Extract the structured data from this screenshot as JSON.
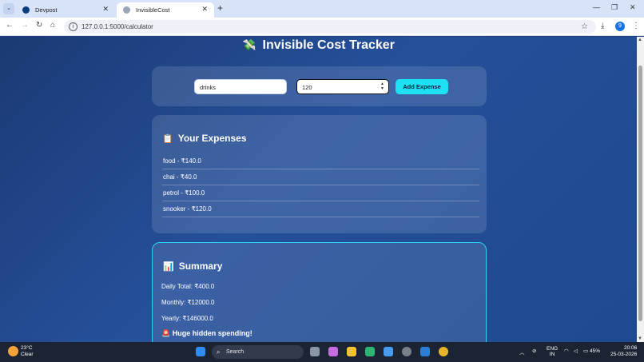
{
  "browser": {
    "tabs": [
      {
        "label": "Devpost"
      },
      {
        "label": "InvisibleCost"
      }
    ],
    "url": "127.0.0.1:5000/calculator",
    "profile_initial": "9"
  },
  "app": {
    "title": "Invisible Cost Tracker",
    "title_emoji": "💸",
    "form": {
      "name_value": "drinks",
      "amount_value": "120",
      "add_label": "Add Expense"
    },
    "expenses": {
      "heading": "Your Expenses",
      "heading_emoji": "📋",
      "items": [
        {
          "label": "food - ₹140.0"
        },
        {
          "label": "chai - ₹40.0"
        },
        {
          "label": "petrol - ₹100.0"
        },
        {
          "label": "snooker - ₹120.0"
        }
      ]
    },
    "summary": {
      "heading": "Summary",
      "heading_emoji": "📊",
      "daily": "Daily Total: ₹400.0",
      "monthly": "Monthly: ₹12000.0",
      "yearly": "Yearly: ₹146000.0",
      "warning": "Huge hidden spending!",
      "warning_emoji": "🚨"
    }
  },
  "taskbar": {
    "weather_temp": "23°C",
    "weather_desc": "Clear",
    "search_placeholder": "Search",
    "lang_top": "ENG",
    "lang_bottom": "IN",
    "battery": "45%",
    "time": "20:06",
    "date": "25-03-2026"
  },
  "colors": {
    "accent_button": "#1ee0f3",
    "summary_border": "#2ed3f0"
  }
}
